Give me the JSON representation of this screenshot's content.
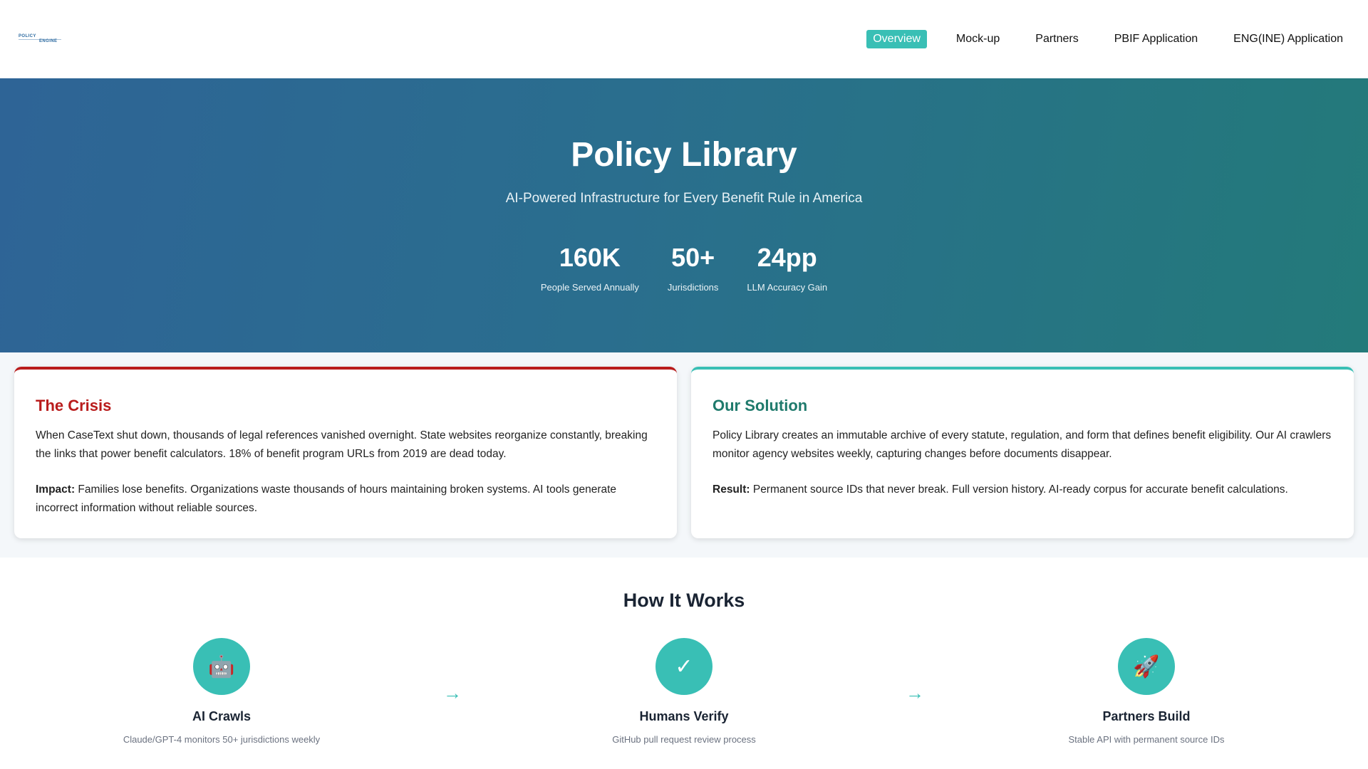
{
  "header": {
    "logo": {
      "line1": "POLICY",
      "line2": "ENGINE"
    },
    "nav": [
      "Overview",
      "Mock-up",
      "Partners",
      "PBIF Application",
      "ENG(INE) Application"
    ],
    "active_nav": "Overview"
  },
  "hero": {
    "title": "Policy Library",
    "subtitle": "AI-Powered Infrastructure for Every Benefit Rule in America",
    "stats": [
      {
        "value": "160K",
        "label": "People Served Annually"
      },
      {
        "value": "50+",
        "label": "Jurisdictions"
      },
      {
        "value": "24pp",
        "label": "LLM Accuracy Gain"
      }
    ]
  },
  "crisis": {
    "title": "The Crisis",
    "body": "When CaseText shut down, thousands of legal references vanished overnight. State websites reorganize constantly, breaking the links that power benefit calculators. 18% of benefit program URLs from 2019 are dead today.",
    "impact_label": "Impact:",
    "impact_text": " Families lose benefits. Organizations waste thousands of hours maintaining broken systems. AI tools generate incorrect information without reliable sources."
  },
  "solution": {
    "title": "Our Solution",
    "body": "Policy Library creates an immutable archive of every statute, regulation, and form that defines benefit eligibility. Our AI crawlers monitor agency websites weekly, capturing changes before documents disappear.",
    "result_label": "Result:",
    "result_text": " Permanent source IDs that never break. Full version history. AI-ready corpus for accurate benefit calculations."
  },
  "how": {
    "title": "How It Works",
    "steps": [
      {
        "icon": "robot-icon",
        "glyph": "🤖",
        "title": "AI Crawls",
        "desc": "Claude/GPT-4 monitors 50+ jurisdictions weekly"
      },
      {
        "icon": "checkmark-icon",
        "glyph": "✓",
        "title": "Humans Verify",
        "desc": "GitHub pull request review process"
      },
      {
        "icon": "rocket-icon",
        "glyph": "🚀",
        "title": "Partners Build",
        "desc": "Stable API with permanent source IDs"
      }
    ],
    "arrow_glyph": "→"
  },
  "colors": {
    "accent": "#39bfb5",
    "crisis": "#b91c1c",
    "solution_title": "#1f7a6c",
    "hero_start": "#2e6496",
    "hero_end": "#237a7a"
  }
}
